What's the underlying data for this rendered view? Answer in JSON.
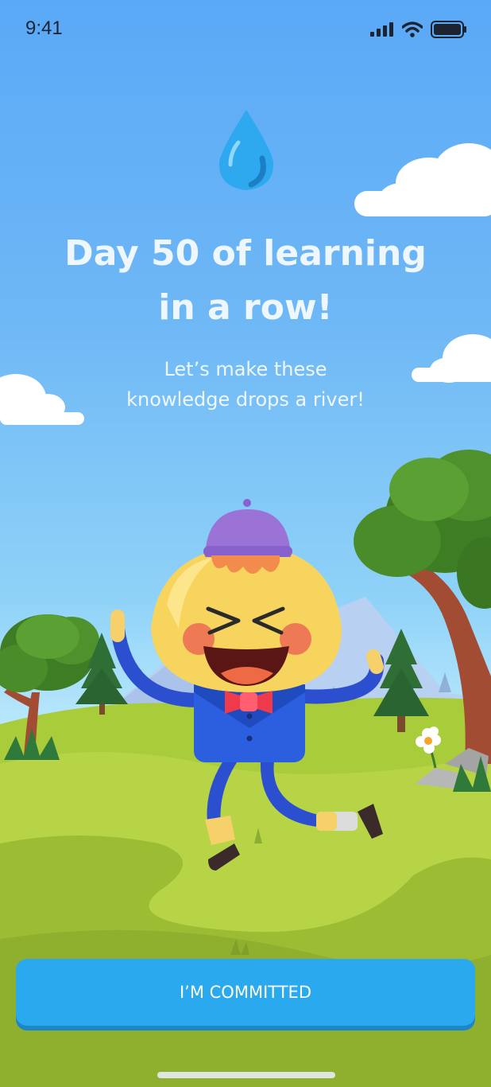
{
  "status_bar": {
    "time": "9:41"
  },
  "headline": {
    "line1": "Day 50 of learning",
    "line2": "in a row!"
  },
  "subtext": {
    "line1": "Let’s make these",
    "line2": "knowledge drops a river!"
  },
  "cta": {
    "label": "I’M COMMITTED"
  },
  "colors": {
    "sky_top": "#5aa9f7",
    "grass": "#9cc636",
    "button": "#2aa9ee",
    "drop": "#2ea8ee"
  }
}
